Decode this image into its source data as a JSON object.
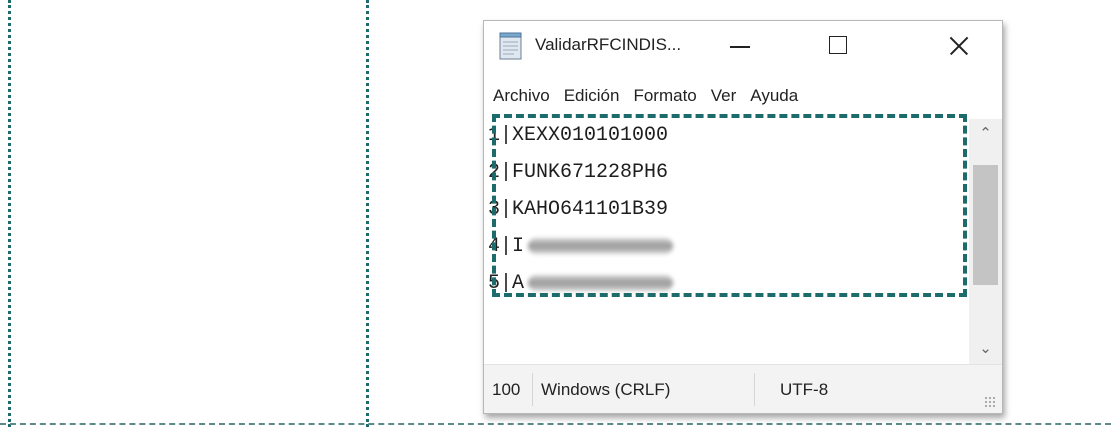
{
  "window": {
    "title": "ValidarRFCINDIS...",
    "icon": "notepad-icon"
  },
  "menu": [
    "Archivo",
    "Edición",
    "Formato",
    "Ver",
    "Ayuda"
  ],
  "lines": [
    {
      "num": "1",
      "text": "XEXX010101000",
      "redacted": false
    },
    {
      "num": "2",
      "text": "FUNK671228PH6",
      "redacted": false
    },
    {
      "num": "3",
      "text": "KAHO641101B39",
      "redacted": false
    },
    {
      "num": "4",
      "text": "I",
      "redacted": true
    },
    {
      "num": "5",
      "text": "A",
      "redacted": true
    }
  ],
  "separator": "|",
  "statusbar": {
    "zoom": "100",
    "line_ending": "Windows (CRLF)",
    "encoding": "UTF-8"
  },
  "colors": {
    "highlight": "#1e6b6b",
    "guide": "#1e6b6b"
  }
}
